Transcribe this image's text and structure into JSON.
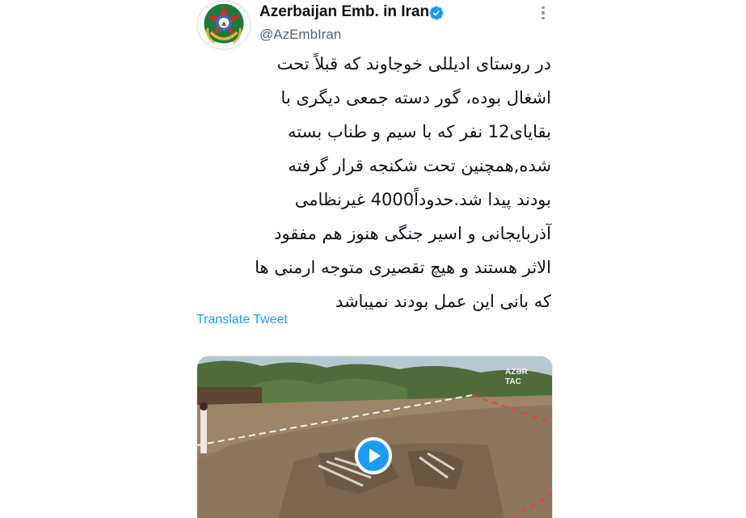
{
  "author": {
    "display_name": "Azerbaijan Emb. in Iran",
    "handle": "@AzEmbIran",
    "verified": true,
    "verified_color": "#1d9bf0"
  },
  "icons": {
    "avatar": "azerbaijan-emblem-avatar",
    "verified": "verified-badge-icon",
    "more": "more-options-icon",
    "play": "play-icon"
  },
  "tweet": {
    "lines": [
      "در روستای ادیللی خوجاوند که قبلاً تحت",
      "اشغال بوده، گور دسته جمعی دیگری با",
      "بقایای12 نفر که با سیم و طناب بسته",
      "شده,همچنین تحت شکنجه قرار گرفته",
      "بودند پیدا شد.حدوداً4000 غیرنظامی",
      "آذربایجانی و اسیر جنگی هنوز هم مفقود",
      "الاثر هستند و هیچ تقصیری متوجه ارمنی ها",
      "که بانی این عمل بودند نمیباشد"
    ],
    "translate_label": "Translate Tweet"
  },
  "media": {
    "type": "video",
    "watermark": "AZƏR TAC"
  },
  "colors": {
    "link": "#1d9bf0",
    "secondary_text": "#536471",
    "primary_text": "#0f1419"
  }
}
